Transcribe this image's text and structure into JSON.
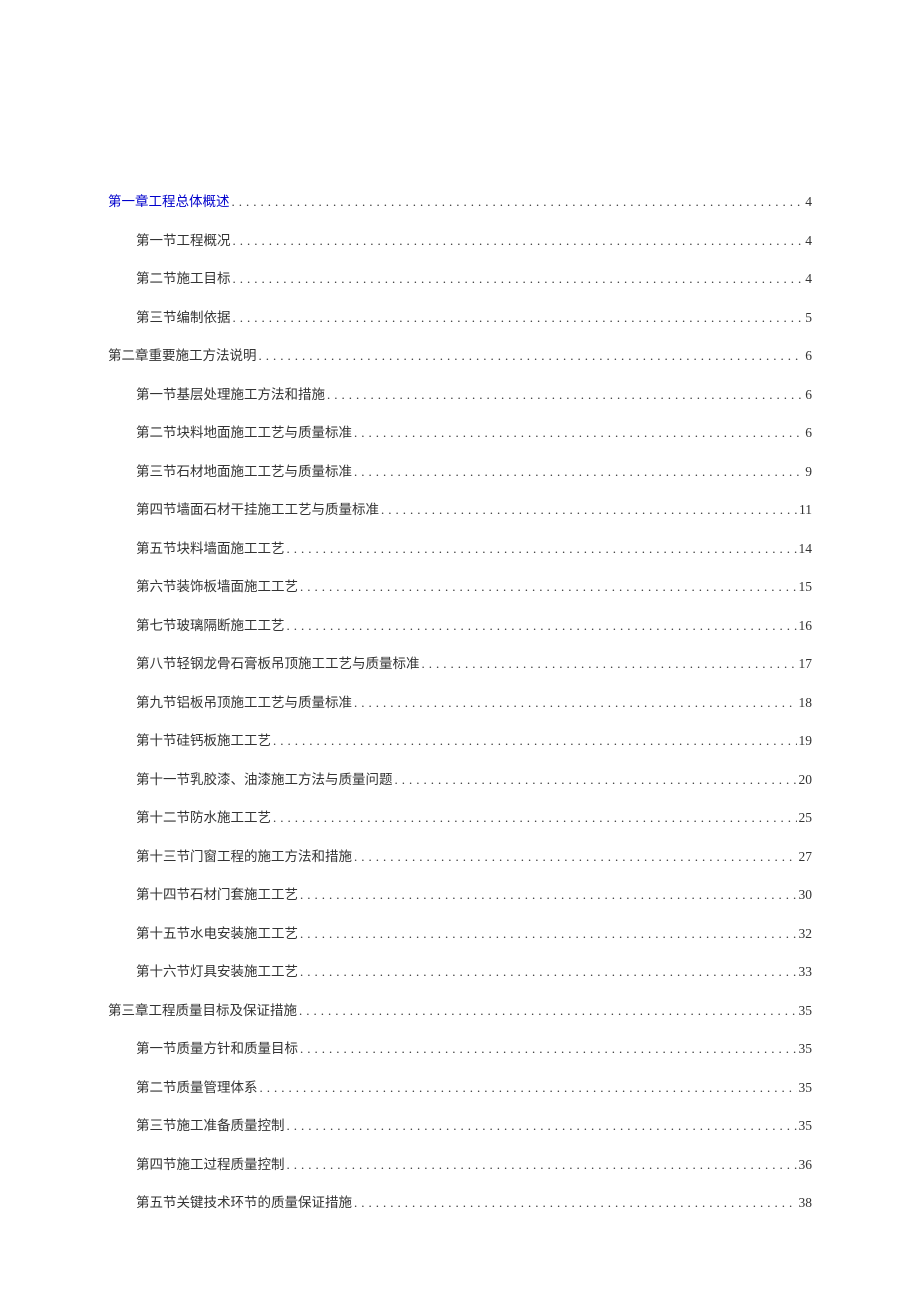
{
  "toc": [
    {
      "level": 1,
      "title": "第一章工程总体概述",
      "page": "4",
      "link": true
    },
    {
      "level": 2,
      "title": "第一节工程概况",
      "page": "4",
      "link": false
    },
    {
      "level": 2,
      "title": "第二节施工目标",
      "page": "4",
      "link": false
    },
    {
      "level": 2,
      "title": "第三节编制依据",
      "page": "5",
      "link": false
    },
    {
      "level": 1,
      "title": "第二章重要施工方法说明",
      "page": "6",
      "link": false
    },
    {
      "level": 2,
      "title": "第一节基层处理施工方法和措施",
      "page": "6",
      "link": false
    },
    {
      "level": 2,
      "title": "第二节块料地面施工工艺与质量标准",
      "page": "6",
      "link": false
    },
    {
      "level": 2,
      "title": "第三节石材地面施工工艺与质量标准",
      "page": "9",
      "link": false
    },
    {
      "level": 2,
      "title": "第四节墙面石材干挂施工工艺与质量标准",
      "page": "11",
      "link": false
    },
    {
      "level": 2,
      "title": "第五节块料墙面施工工艺",
      "page": "14",
      "link": false
    },
    {
      "level": 2,
      "title": "第六节装饰板墙面施工工艺",
      "page": "15",
      "link": false
    },
    {
      "level": 2,
      "title": "第七节玻璃隔断施工工艺",
      "page": "16",
      "link": false
    },
    {
      "level": 2,
      "title": "第八节轻钢龙骨石膏板吊顶施工工艺与质量标准",
      "page": "17",
      "link": false
    },
    {
      "level": 2,
      "title": "第九节铝板吊顶施工工艺与质量标准",
      "page": "18",
      "link": false
    },
    {
      "level": 2,
      "title": "第十节硅钙板施工工艺",
      "page": "19",
      "link": false
    },
    {
      "level": 2,
      "title": "第十一节乳胶漆、油漆施工方法与质量问题",
      "page": "20",
      "link": false
    },
    {
      "level": 2,
      "title": "第十二节防水施工工艺",
      "page": "25",
      "link": false
    },
    {
      "level": 2,
      "title": "第十三节门窗工程的施工方法和措施",
      "page": "27",
      "link": false
    },
    {
      "level": 2,
      "title": "第十四节石材门套施工工艺",
      "page": "30",
      "link": false
    },
    {
      "level": 2,
      "title": "第十五节水电安装施工工艺",
      "page": "32",
      "link": false
    },
    {
      "level": 2,
      "title": "第十六节灯具安装施工工艺",
      "page": "33",
      "link": false
    },
    {
      "level": 1,
      "title": "第三章工程质量目标及保证措施",
      "page": "35",
      "link": false
    },
    {
      "level": 2,
      "title": "第一节质量方针和质量目标",
      "page": "35",
      "link": false
    },
    {
      "level": 2,
      "title": "第二节质量管理体系",
      "page": "35",
      "link": false
    },
    {
      "level": 2,
      "title": "第三节施工准备质量控制",
      "page": "35",
      "link": false
    },
    {
      "level": 2,
      "title": "第四节施工过程质量控制",
      "page": "36",
      "link": false
    },
    {
      "level": 2,
      "title": "第五节关键技术环节的质量保证措施",
      "page": "38",
      "link": false
    }
  ],
  "dots": "..................................................................................................................."
}
